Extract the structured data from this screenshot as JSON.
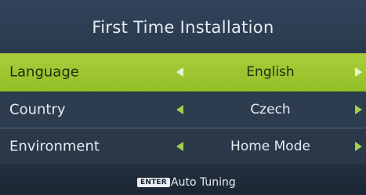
{
  "header": {
    "title": "First Time Installation"
  },
  "settings": [
    {
      "label": "Language",
      "value": "English",
      "selected": true
    },
    {
      "label": "Country",
      "value": "Czech",
      "selected": false
    },
    {
      "label": "Environment",
      "value": "Home Mode",
      "selected": false
    }
  ],
  "footer": {
    "key_label": "ENTER",
    "action_label": "Auto Tuning"
  },
  "colors": {
    "selected_row": "#9cc52f",
    "arrow_green": "#9fd24a",
    "background": "#2b3a4d"
  },
  "icons": {
    "left": "left-triangle-icon",
    "right": "right-triangle-icon"
  }
}
